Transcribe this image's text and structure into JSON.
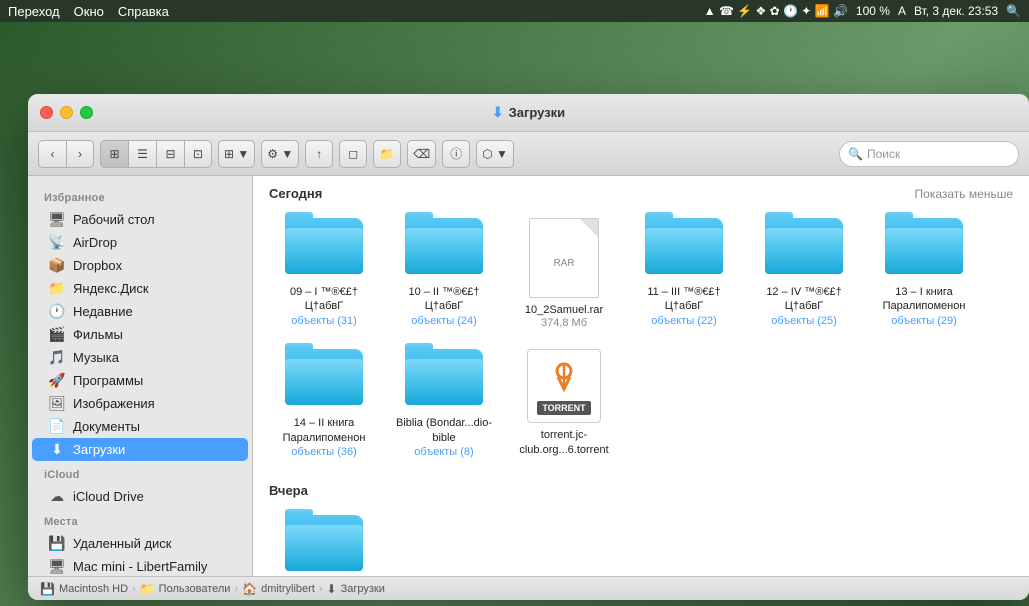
{
  "menubar": {
    "left": [
      "Переход",
      "Окно",
      "Справка"
    ],
    "right_text": "Вт, 3 дек.  23:53",
    "battery": "100 %"
  },
  "window": {
    "title": "Загрузки",
    "title_icon": "⬇"
  },
  "toolbar": {
    "back_label": "‹",
    "forward_label": "›",
    "view_icon_label": "⊞",
    "view_list_label": "☰",
    "view_col_label": "⊟",
    "view_cov_label": "⊡",
    "view_grp_label": "⊞▼",
    "action_label": "⚙▼",
    "share_label": "↑",
    "tag_label": "◻",
    "folder_label": "📁",
    "delete_label": "⌫",
    "info_label": "ⓘ",
    "dropbox_label": "⬡▼",
    "search_placeholder": "Поиск"
  },
  "sidebar": {
    "sections": [
      {
        "label": "Избранное",
        "items": [
          {
            "id": "desktop",
            "icon": "🖥",
            "label": "Рабочий стол"
          },
          {
            "id": "airdrop",
            "icon": "📡",
            "label": "AirDrop"
          },
          {
            "id": "dropbox",
            "icon": "📦",
            "label": "Dropbox"
          },
          {
            "id": "yandex",
            "icon": "📁",
            "label": "Яндекс.Диск"
          },
          {
            "id": "recent",
            "icon": "🕐",
            "label": "Недавние"
          },
          {
            "id": "movies",
            "icon": "🎬",
            "label": "Фильмы"
          },
          {
            "id": "music",
            "icon": "🎵",
            "label": "Музыка"
          },
          {
            "id": "programs",
            "icon": "🚀",
            "label": "Программы"
          },
          {
            "id": "images",
            "icon": "🖼",
            "label": "Изображения"
          },
          {
            "id": "documents",
            "icon": "📄",
            "label": "Документы"
          },
          {
            "id": "downloads",
            "icon": "⬇",
            "label": "Загрузки",
            "active": true
          }
        ]
      },
      {
        "label": "iCloud",
        "items": [
          {
            "id": "icloud",
            "icon": "☁",
            "label": "iCloud Drive"
          }
        ]
      },
      {
        "label": "Места",
        "items": [
          {
            "id": "remote",
            "icon": "💾",
            "label": "Удаленный диск"
          },
          {
            "id": "macmini",
            "icon": "🖥",
            "label": "Mac mini - LibertFamily"
          }
        ]
      }
    ]
  },
  "sections": [
    {
      "id": "today",
      "title": "Сегодня",
      "toggle": "Показать меньше",
      "files": [
        {
          "id": "f1",
          "type": "folder",
          "name": "09 – I ™®€£†\nЦ†абвГ",
          "subtitle": "объекты (31)"
        },
        {
          "id": "f2",
          "type": "folder",
          "name": "10 – II ™®€£†\nЦ†абвГ",
          "subtitle": "объекты (24)"
        },
        {
          "id": "f3",
          "type": "rar",
          "name": "10_2Samuel.rar",
          "size": "374,8 Мб"
        },
        {
          "id": "f4",
          "type": "folder",
          "name": "11 – III ™®€£†\nЦ†абвГ",
          "subtitle": "объекты (22)"
        },
        {
          "id": "f5",
          "type": "folder",
          "name": "12 – IV ™®€£†\nЦ†абвГ",
          "subtitle": "объекты (25)"
        },
        {
          "id": "f6",
          "type": "folder",
          "name": "13 – I книга\nПаралипоменон",
          "subtitle": "объекты (29)"
        },
        {
          "id": "f7",
          "type": "folder",
          "name": "14 – II книга\nПаралипоменон",
          "subtitle": "объекты (36)"
        },
        {
          "id": "f8",
          "type": "folder",
          "name": "Biblia\n(Bondar...dio-bible",
          "subtitle": "объекты (8)"
        },
        {
          "id": "f9",
          "type": "torrent",
          "name": "torrent.jc-club.org...6.torrent",
          "subtitle": ""
        }
      ]
    },
    {
      "id": "yesterday",
      "title": "Вчера",
      "toggle": "",
      "files": [
        {
          "id": "fy1",
          "type": "folder",
          "name": "",
          "subtitle": ""
        }
      ]
    }
  ],
  "breadcrumb": [
    {
      "icon": "💾",
      "label": "Macintosh HD"
    },
    {
      "icon": "📁",
      "label": "Пользователи"
    },
    {
      "icon": "🏠",
      "label": "dmitrylibert"
    },
    {
      "icon": "⬇",
      "label": "Загрузки"
    }
  ]
}
